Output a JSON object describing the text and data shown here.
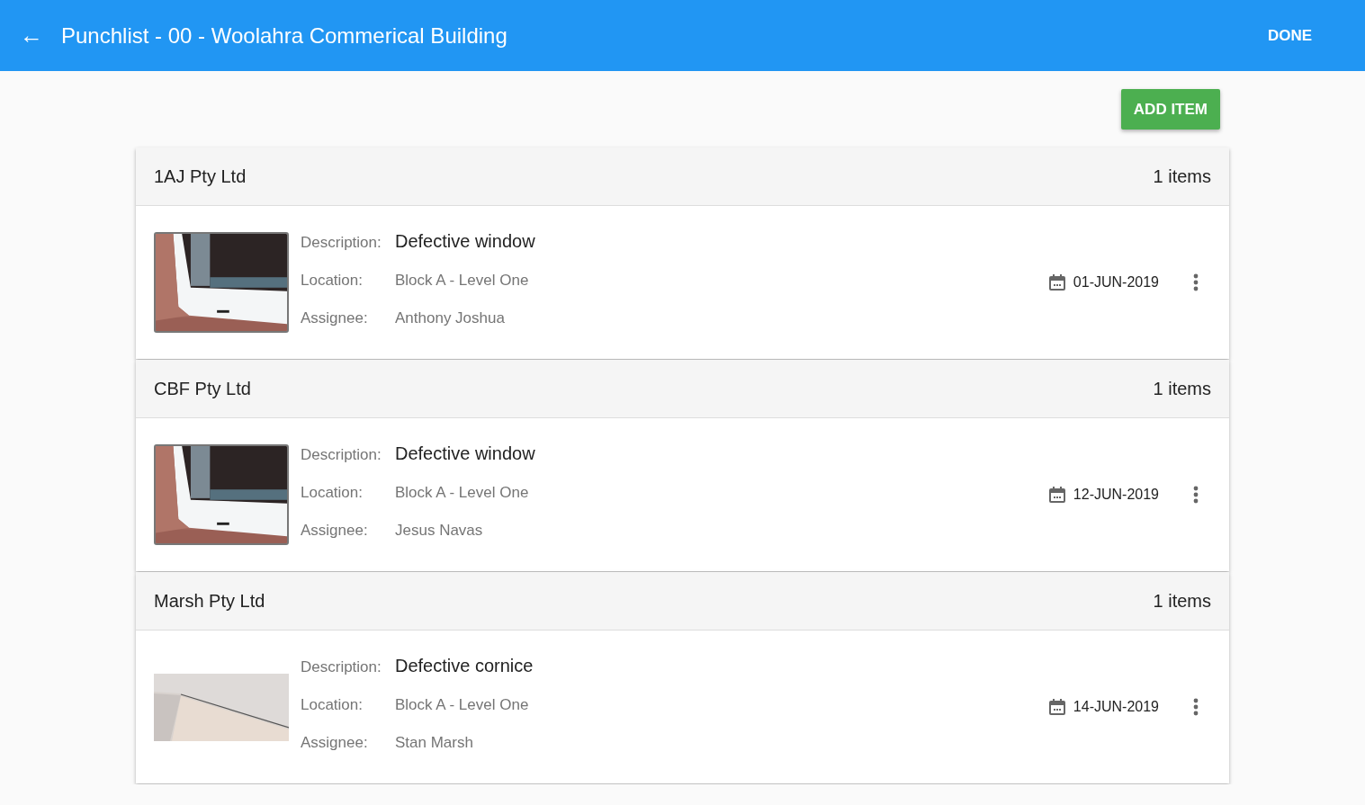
{
  "header": {
    "back_icon": "←",
    "title": "Punchlist - 00 - Woolahra Commerical Building",
    "done": "DONE"
  },
  "add_button": "ADD ITEM",
  "groups": [
    {
      "company": "1AJ Pty Ltd",
      "count": "1 items",
      "items": [
        {
          "description_label": "Description:",
          "description": "Defective window",
          "location_label": "Location:",
          "location": "Block A - Level One",
          "assignee_label": "Assignee:",
          "assignee": "Anthony Joshua",
          "date": "01-JUN-2019"
        }
      ]
    },
    {
      "company": "CBF Pty Ltd",
      "count": "1 items",
      "items": [
        {
          "description_label": "Description:",
          "description": "Defective window",
          "location_label": "Location:",
          "location": "Block A - Level One",
          "assignee_label": "Assignee:",
          "assignee": "Jesus Navas",
          "date": "12-JUN-2019"
        }
      ]
    },
    {
      "company": "Marsh Pty Ltd",
      "count": "1 items",
      "items": [
        {
          "description_label": "Description:",
          "description": "Defective cornice",
          "location_label": "Location:",
          "location": "Block A - Level One",
          "assignee_label": "Assignee:",
          "assignee": "Stan Marsh",
          "date": "14-JUN-2019"
        }
      ]
    }
  ]
}
